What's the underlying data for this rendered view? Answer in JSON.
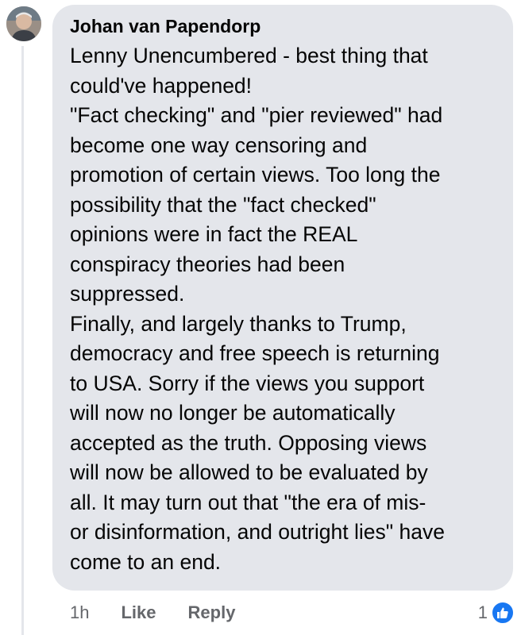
{
  "comment": {
    "author": "Johan van Papendorp",
    "lines": [
      "Lenny Unencumbered - best thing that",
      "could've happened!",
      "\"Fact checking\"  and \"pier reviewed\" had",
      "become one way censoring and",
      "promotion of certain views. Too long the",
      "possibility that the \"fact checked\"",
      "opinions were in fact the REAL",
      "conspiracy theories had been",
      "suppressed.",
      "Finally, and largely thanks to Trump,",
      "democracy and free speech is returning",
      "to USA.  Sorry if the views you support",
      "will now no longer be automatically",
      "accepted as the truth. Opposing views",
      "will now be allowed to be evaluated by",
      "all. It may turn out that \"the era of mis-",
      "or disinformation, and outright lies\" have",
      "come to an end."
    ]
  },
  "actions": {
    "timestamp": "1h",
    "like_label": "Like",
    "reply_label": "Reply"
  },
  "reactions": {
    "count": "1",
    "icon": "thumbs-up-icon",
    "color": "#1877f2"
  }
}
